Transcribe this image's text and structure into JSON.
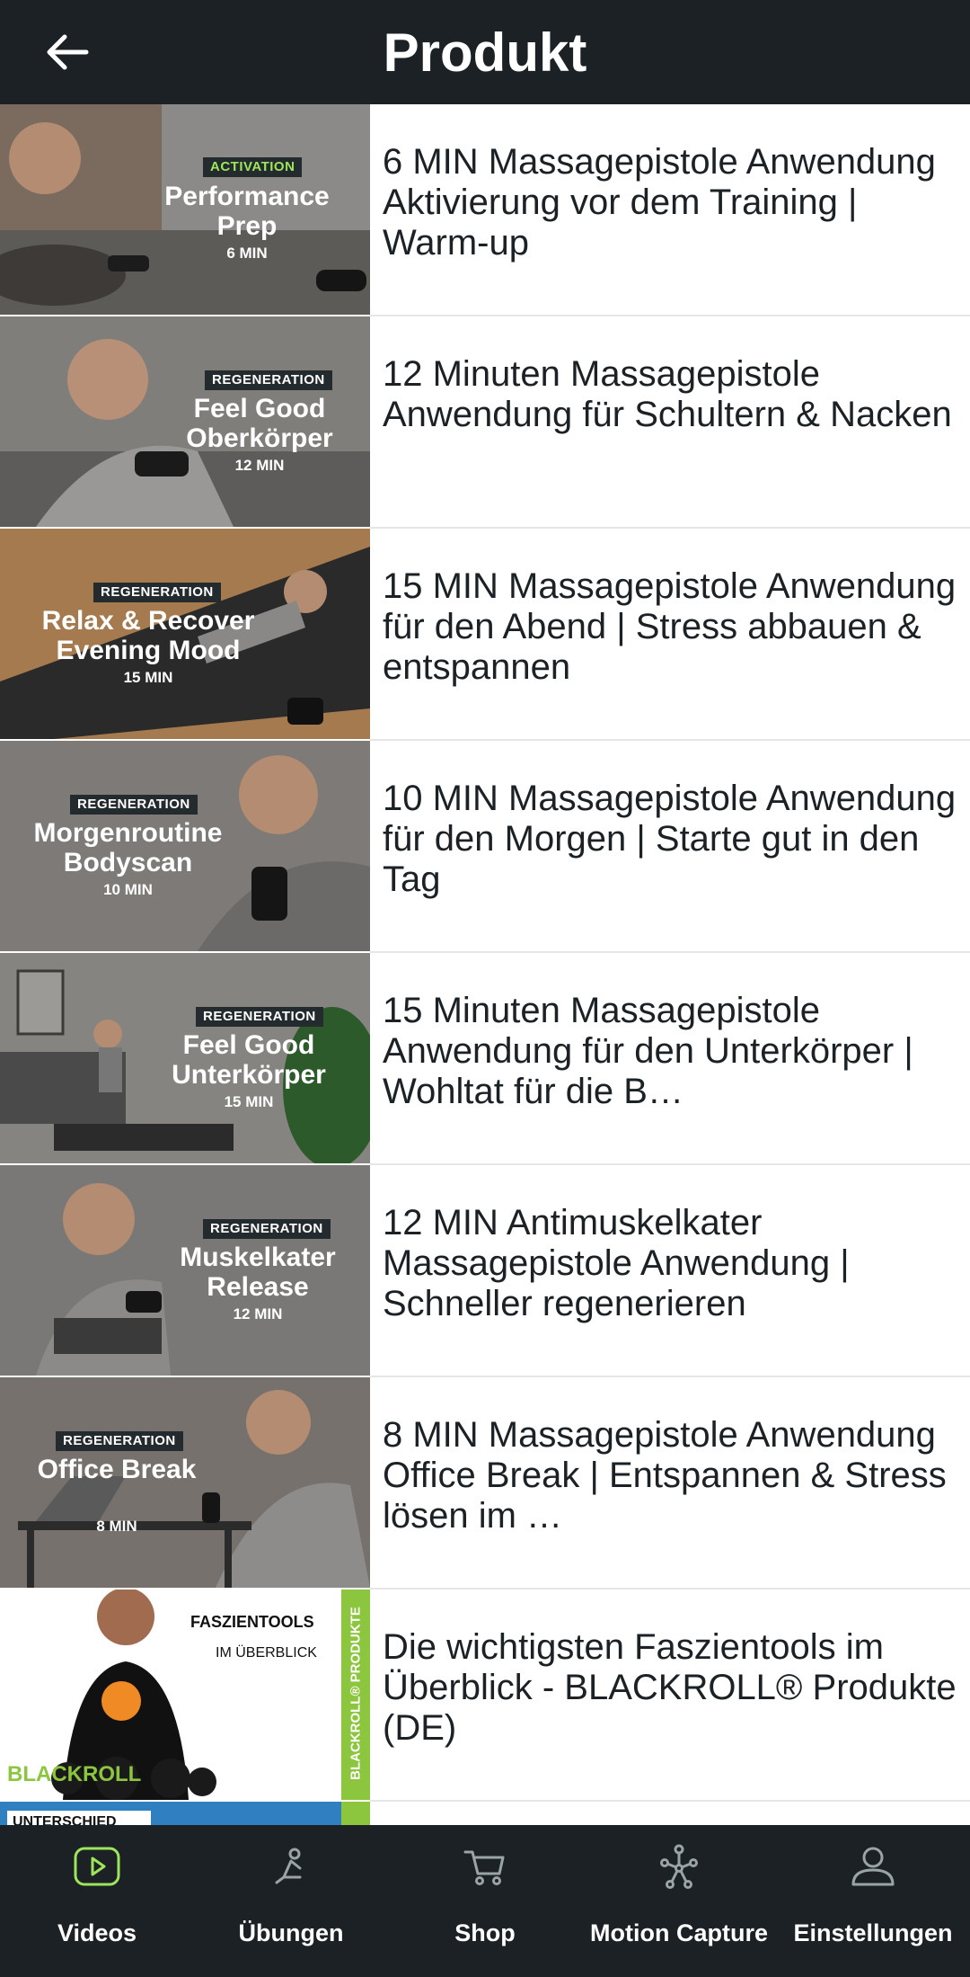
{
  "header": {
    "title": "Produkt",
    "back_icon": "arrow-left-icon"
  },
  "videos": [
    {
      "title": "6 MIN Massagepistole Anwendung Aktivierung vor dem Training | Warm-up",
      "tag": "ACTIVATION",
      "headline": "Performance Prep",
      "duration": "6 MIN"
    },
    {
      "title": "12 Minuten Massagepistole Anwendung für Schultern & Nacken",
      "tag": "REGENERATION",
      "headline": "Feel Good Oberkörper",
      "duration": "12 MIN"
    },
    {
      "title": "15 MIN Massagepistole Anwendung für den Abend | Stress abbauen & entspannen",
      "tag": "REGENERATION",
      "headline": "Relax & Recover Evening Mood",
      "duration": "15 MIN"
    },
    {
      "title": "10 MIN Massagepistole Anwendung für den Morgen | Starte gut in den Tag",
      "tag": "REGENERATION",
      "headline": "Morgenroutine Bodyscan",
      "duration": "10 MIN"
    },
    {
      "title": "15 Minuten Massagepistole Anwendung für den Unterkörper | Wohltat für die B…",
      "tag": "REGENERATION",
      "headline": "Feel Good Unterkörper",
      "duration": "15 MIN"
    },
    {
      "title": "12 MIN Antimuskelkater Massagepistole Anwendung | Schneller regenerieren",
      "tag": "REGENERATION",
      "headline": "Muskelkater Release",
      "duration": "12 MIN"
    },
    {
      "title": "8 MIN Massagepistole Anwendung Office Break | Entspannen & Stress lösen im …",
      "tag": "REGENERATION",
      "headline": "Office Break",
      "duration": "8 MIN"
    },
    {
      "title": "Die wichtigsten Faszientools im Überblick - BLACKROLL® Produkte (DE)",
      "thumb_title": "FASZIENTOOLS",
      "thumb_subtitle": "IM ÜBERBLICK",
      "side_label": "BLACKROLL® PRODUKTE",
      "brand": "BLACKROLL"
    }
  ],
  "partial_thumb_label": "UNTERSCHIED",
  "nav": [
    {
      "label": "Videos",
      "icon": "play-icon",
      "active": true
    },
    {
      "label": "Übungen",
      "icon": "exercise-icon",
      "active": false
    },
    {
      "label": "Shop",
      "icon": "cart-icon",
      "active": false
    },
    {
      "label": "Motion Capture",
      "icon": "motion-capture-icon",
      "active": false
    },
    {
      "label": "Einstellungen",
      "icon": "user-icon",
      "active": false
    }
  ],
  "colors": {
    "header_bg": "#1b2124",
    "nav_bg": "#1b2124",
    "accent_green": "#9fe55b",
    "text": "#1b2124"
  }
}
